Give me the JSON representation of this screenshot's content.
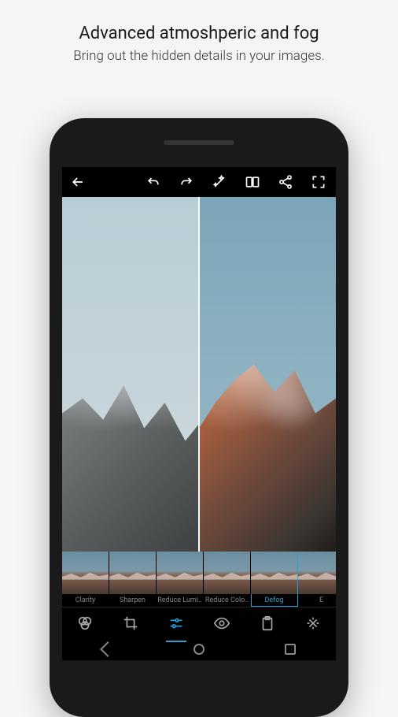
{
  "promo": {
    "headline": "Advanced atmoshperic and fog",
    "subline": "Bring out the hidden details in your images."
  },
  "topbar": {
    "back": "←",
    "actions": [
      "undo",
      "redo",
      "magic",
      "compare",
      "share",
      "fullscreen"
    ]
  },
  "thumbs": [
    {
      "label": "Clarity",
      "active": false
    },
    {
      "label": "Sharpen",
      "active": false
    },
    {
      "label": "Reduce Lumi..",
      "active": false
    },
    {
      "label": "Reduce Colo..",
      "active": false
    },
    {
      "label": "Defog",
      "active": true
    },
    {
      "label": "E",
      "active": false
    }
  ],
  "tools": [
    {
      "name": "looks",
      "active": false
    },
    {
      "name": "crop",
      "active": false
    },
    {
      "name": "adjust",
      "active": true
    },
    {
      "name": "eye",
      "active": false
    },
    {
      "name": "clipboard",
      "active": false
    },
    {
      "name": "heal",
      "active": false
    }
  ]
}
